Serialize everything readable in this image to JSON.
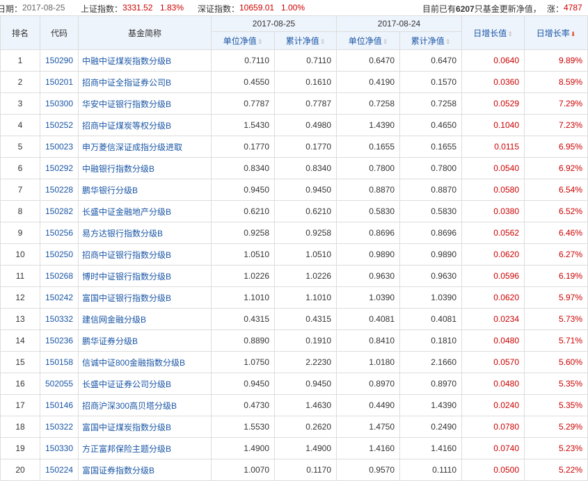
{
  "topbar": {
    "date_label": "日期：",
    "date_value": "2017-08-25",
    "sh_label": "上证指数：",
    "sh_value": "3331.52",
    "sh_change": "1.83%",
    "sz_label": "深证指数：",
    "sz_value": "10659.01",
    "sz_change": "1.00%",
    "summary_prefix": "目前已有",
    "summary_count": "6207",
    "summary_suffix": "只基金更新净值，",
    "rise_label": "涨：",
    "rise_value": "4787"
  },
  "table": {
    "headers": {
      "rank": "排名",
      "code": "代码",
      "name": "基金简称",
      "date1": "2017-08-25",
      "date2": "2017-08-24",
      "unit_nav": "单位净值",
      "acc_nav": "累计净值",
      "daily_change": "日增长值",
      "daily_rate": "日增长率",
      "sort_icon": "⇕",
      "sort_active_icon": "⬇"
    },
    "rows": [
      {
        "rank": "1",
        "code": "150290",
        "name": "中融中证煤炭指数分级B",
        "unit1": "0.7110",
        "acc1": "0.7110",
        "unit2": "0.6470",
        "acc2": "0.6470",
        "chg": "0.0640",
        "rate": "9.89%"
      },
      {
        "rank": "2",
        "code": "150201",
        "name": "招商中证全指证券公司B",
        "unit1": "0.4550",
        "acc1": "0.1610",
        "unit2": "0.4190",
        "acc2": "0.1570",
        "chg": "0.0360",
        "rate": "8.59%"
      },
      {
        "rank": "3",
        "code": "150300",
        "name": "华安中证银行指数分级B",
        "unit1": "0.7787",
        "acc1": "0.7787",
        "unit2": "0.7258",
        "acc2": "0.7258",
        "chg": "0.0529",
        "rate": "7.29%"
      },
      {
        "rank": "4",
        "code": "150252",
        "name": "招商中证煤炭等权分级B",
        "unit1": "1.5430",
        "acc1": "0.4980",
        "unit2": "1.4390",
        "acc2": "0.4650",
        "chg": "0.1040",
        "rate": "7.23%"
      },
      {
        "rank": "5",
        "code": "150023",
        "name": "申万菱信深证成指分级进取",
        "unit1": "0.1770",
        "acc1": "0.1770",
        "unit2": "0.1655",
        "acc2": "0.1655",
        "chg": "0.0115",
        "rate": "6.95%"
      },
      {
        "rank": "6",
        "code": "150292",
        "name": "中融银行指数分级B",
        "unit1": "0.8340",
        "acc1": "0.8340",
        "unit2": "0.7800",
        "acc2": "0.7800",
        "chg": "0.0540",
        "rate": "6.92%"
      },
      {
        "rank": "7",
        "code": "150228",
        "name": "鹏华银行分级B",
        "unit1": "0.9450",
        "acc1": "0.9450",
        "unit2": "0.8870",
        "acc2": "0.8870",
        "chg": "0.0580",
        "rate": "6.54%"
      },
      {
        "rank": "8",
        "code": "150282",
        "name": "长盛中证金融地产分级B",
        "unit1": "0.6210",
        "acc1": "0.6210",
        "unit2": "0.5830",
        "acc2": "0.5830",
        "chg": "0.0380",
        "rate": "6.52%"
      },
      {
        "rank": "9",
        "code": "150256",
        "name": "易方达银行指数分级B",
        "unit1": "0.9258",
        "acc1": "0.9258",
        "unit2": "0.8696",
        "acc2": "0.8696",
        "chg": "0.0562",
        "rate": "6.46%"
      },
      {
        "rank": "10",
        "code": "150250",
        "name": "招商中证银行指数分级B",
        "unit1": "1.0510",
        "acc1": "1.0510",
        "unit2": "0.9890",
        "acc2": "0.9890",
        "chg": "0.0620",
        "rate": "6.27%"
      },
      {
        "rank": "11",
        "code": "150268",
        "name": "博时中证银行指数分级B",
        "unit1": "1.0226",
        "acc1": "1.0226",
        "unit2": "0.9630",
        "acc2": "0.9630",
        "chg": "0.0596",
        "rate": "6.19%"
      },
      {
        "rank": "12",
        "code": "150242",
        "name": "富国中证银行指数分级B",
        "unit1": "1.1010",
        "acc1": "1.1010",
        "unit2": "1.0390",
        "acc2": "1.0390",
        "chg": "0.0620",
        "rate": "5.97%"
      },
      {
        "rank": "13",
        "code": "150332",
        "name": "建信网金融分级B",
        "unit1": "0.4315",
        "acc1": "0.4315",
        "unit2": "0.4081",
        "acc2": "0.4081",
        "chg": "0.0234",
        "rate": "5.73%"
      },
      {
        "rank": "14",
        "code": "150236",
        "name": "鹏华证券分级B",
        "unit1": "0.8890",
        "acc1": "0.1910",
        "unit2": "0.8410",
        "acc2": "0.1810",
        "chg": "0.0480",
        "rate": "5.71%"
      },
      {
        "rank": "15",
        "code": "150158",
        "name": "信诚中证800金融指数分级B",
        "unit1": "1.0750",
        "acc1": "2.2230",
        "unit2": "1.0180",
        "acc2": "2.1660",
        "chg": "0.0570",
        "rate": "5.60%"
      },
      {
        "rank": "16",
        "code": "502055",
        "name": "长盛中证证券公司分级B",
        "unit1": "0.9450",
        "acc1": "0.9450",
        "unit2": "0.8970",
        "acc2": "0.8970",
        "chg": "0.0480",
        "rate": "5.35%"
      },
      {
        "rank": "17",
        "code": "150146",
        "name": "招商沪深300高贝塔分级B",
        "unit1": "0.4730",
        "acc1": "1.4630",
        "unit2": "0.4490",
        "acc2": "1.4390",
        "chg": "0.0240",
        "rate": "5.35%"
      },
      {
        "rank": "18",
        "code": "150322",
        "name": "富国中证煤炭指数分级B",
        "unit1": "1.5530",
        "acc1": "0.2620",
        "unit2": "1.4750",
        "acc2": "0.2490",
        "chg": "0.0780",
        "rate": "5.29%"
      },
      {
        "rank": "19",
        "code": "150330",
        "name": "方正富邦保险主题分级B",
        "unit1": "1.4900",
        "acc1": "1.4900",
        "unit2": "1.4160",
        "acc2": "1.4160",
        "chg": "0.0740",
        "rate": "5.23%"
      },
      {
        "rank": "20",
        "code": "150224",
        "name": "富国证券指数分级B",
        "unit1": "1.0070",
        "acc1": "0.1170",
        "unit2": "0.9570",
        "acc2": "0.1110",
        "chg": "0.0500",
        "rate": "5.22%"
      }
    ]
  },
  "colors": {
    "header_bg": "#eef4fc",
    "link_blue": "#1a56a6",
    "up_red": "#cc0000",
    "sort_orange": "#e3451f",
    "border": "#dddddd"
  }
}
